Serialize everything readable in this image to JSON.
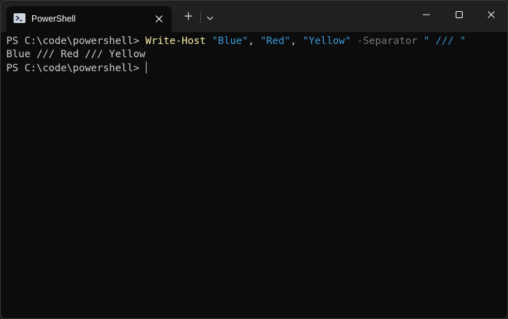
{
  "window": {
    "tab_title": "PowerShell",
    "icons": {
      "tab": "powershell-icon",
      "tab_close": "close-icon",
      "new_tab": "plus-icon",
      "dropdown": "chevron-down-icon",
      "minimize": "minimize-icon",
      "maximize": "maximize-icon",
      "close": "close-icon"
    }
  },
  "terminal": {
    "line1": {
      "prompt": "PS C:\\code\\powershell> ",
      "command": "Write-Host",
      "sp1": " ",
      "arg1": "\"Blue\"",
      "comma1": ", ",
      "arg2": "\"Red\"",
      "comma2": ", ",
      "arg3": "\"Yellow\"",
      "sp2": " ",
      "param": "-Separator",
      "sp3": " ",
      "sep_value": "\" /// \""
    },
    "line2": {
      "output": "Blue /// Red /// Yellow"
    },
    "line3": {
      "prompt": "PS C:\\code\\powershell> "
    }
  },
  "colors": {
    "background": "#0c0c0c",
    "titlebar": "#202020",
    "text": "#cccccc",
    "command": "#f9f1a5",
    "string": "#3b9bd8",
    "parameter": "#767676"
  }
}
